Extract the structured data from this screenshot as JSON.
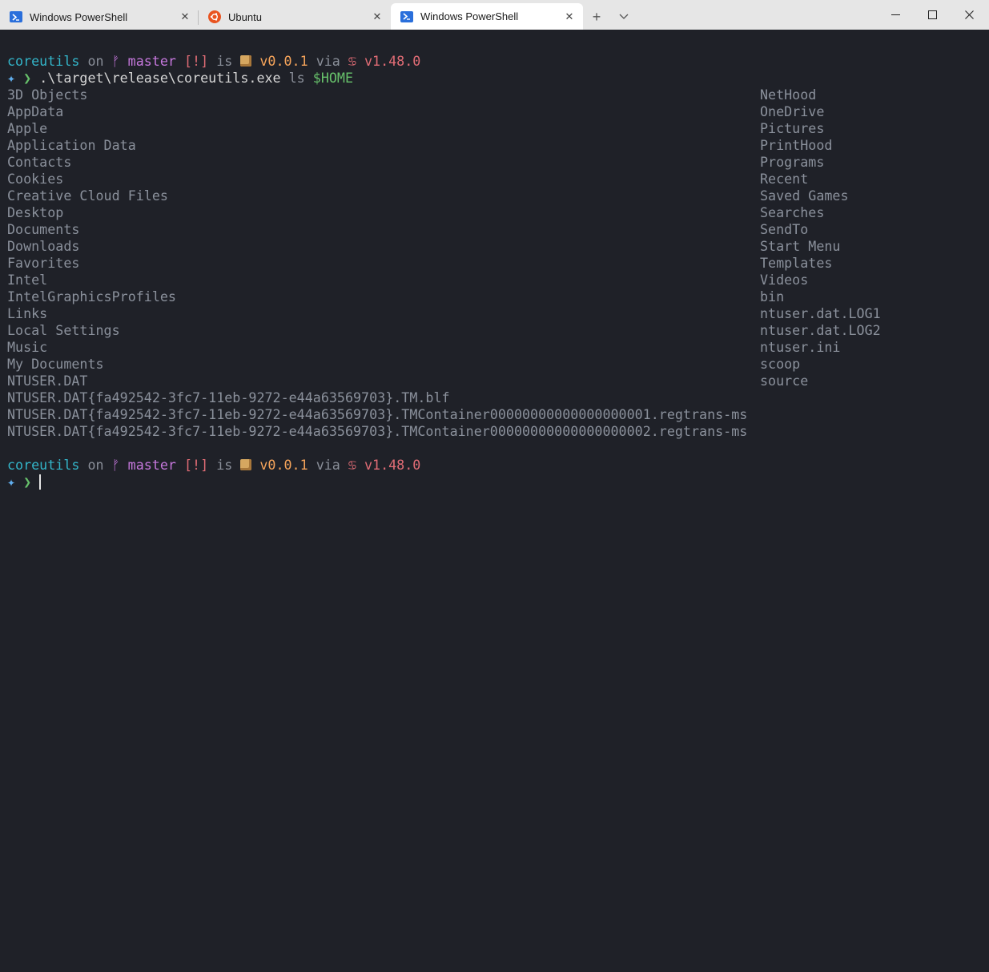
{
  "tabs": [
    {
      "label": "Windows PowerShell",
      "icon": "powershell-icon",
      "active": false
    },
    {
      "label": "Ubuntu",
      "icon": "ubuntu-icon",
      "active": false
    },
    {
      "label": "Windows PowerShell",
      "icon": "powershell-icon",
      "active": true
    }
  ],
  "window_controls": {
    "new_tab": "+",
    "dropdown": "⌄",
    "minimize": "—",
    "maximize": "☐",
    "close": "✕"
  },
  "prompt": {
    "dir": "coreutils",
    "on": "on",
    "branch_icon": "git-branch-icon",
    "branch": "master",
    "status": "[!]",
    "is": "is",
    "package_icon": "package-icon",
    "version": "v0.0.1",
    "via": "via",
    "rust_icon": "rust-crab-icon",
    "rust_version": "v1.48.0",
    "symbol": "✦",
    "arrow": "❯"
  },
  "command": {
    "exe": ".\\target\\release\\coreutils.exe",
    "arg": "ls",
    "var": "$HOME"
  },
  "listing_col1": [
    "3D Objects",
    "AppData",
    "Apple",
    "Application Data",
    "Contacts",
    "Cookies",
    "Creative Cloud Files",
    "Desktop",
    "Documents",
    "Downloads",
    "Favorites",
    "Intel",
    "IntelGraphicsProfiles",
    "Links",
    "Local Settings",
    "Music",
    "My Documents",
    "NTUSER.DAT",
    "NTUSER.DAT{fa492542-3fc7-11eb-9272-e44a63569703}.TM.blf",
    "NTUSER.DAT{fa492542-3fc7-11eb-9272-e44a63569703}.TMContainer00000000000000000001.regtrans-ms",
    "NTUSER.DAT{fa492542-3fc7-11eb-9272-e44a63569703}.TMContainer00000000000000000002.regtrans-ms"
  ],
  "listing_col2": [
    "NetHood",
    "OneDrive",
    "Pictures",
    "PrintHood",
    "Programs",
    "Recent",
    "Saved Games",
    "Searches",
    "SendTo",
    "Start Menu",
    "Templates",
    "Videos",
    "bin",
    "ntuser.dat.LOG1",
    "ntuser.dat.LOG2",
    "ntuser.ini",
    "scoop",
    "source"
  ],
  "colors": {
    "dir": "#33b5c9",
    "branch": "#c678dd",
    "status": "#e06c75",
    "version": "#f4a35a",
    "arrow": "#67c16b",
    "background": "#1f2128"
  }
}
